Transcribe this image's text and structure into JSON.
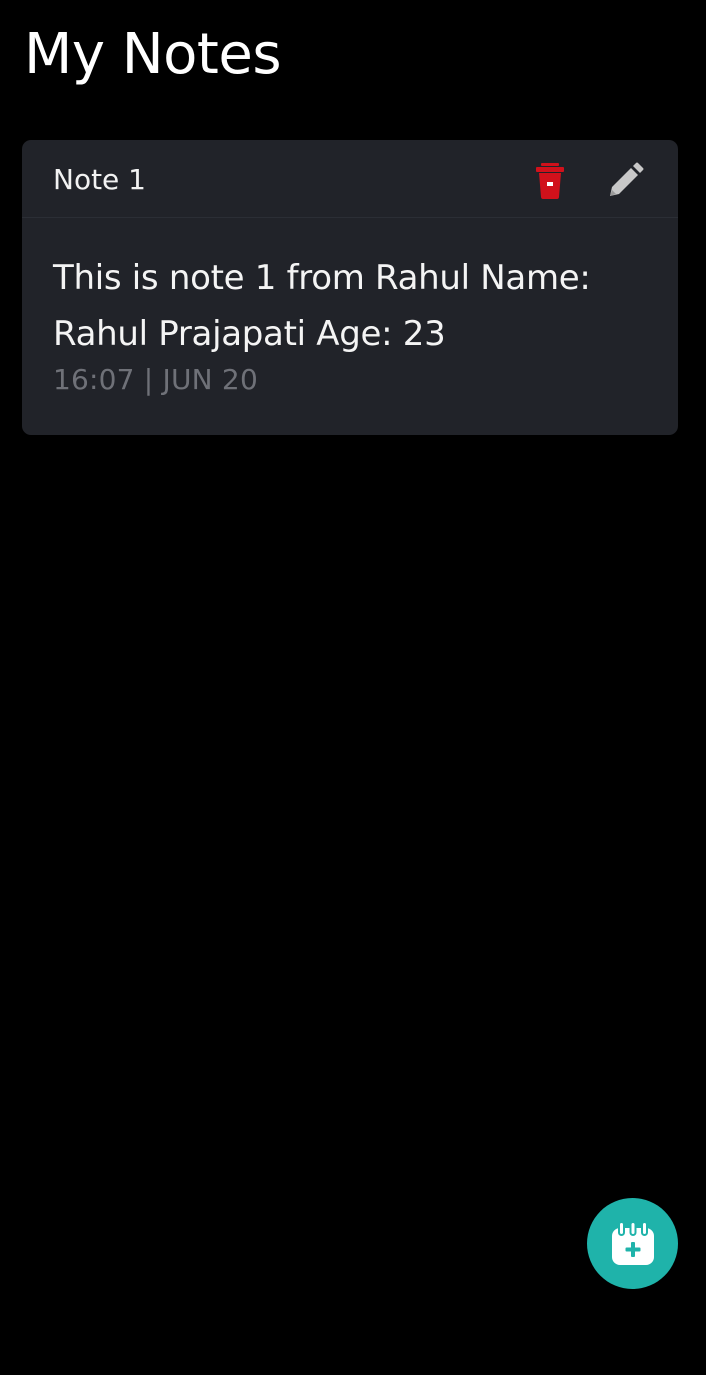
{
  "header": {
    "title": "My Notes"
  },
  "notes": [
    {
      "title": "Note 1",
      "body": "This is note 1 from Rahul Name: Rahul Prajapati Age: 23",
      "timestamp": "16:07 | JUN 20",
      "delete_icon": "trash-icon",
      "edit_icon": "pencil-icon"
    }
  ],
  "fab": {
    "icon": "calendar-add-icon"
  },
  "colors": {
    "background": "#000000",
    "card": "#212329",
    "delete": "#d1111b",
    "edit": "#c8c8c8",
    "fab": "#1fb3aa",
    "meta_text": "#6f7178"
  }
}
